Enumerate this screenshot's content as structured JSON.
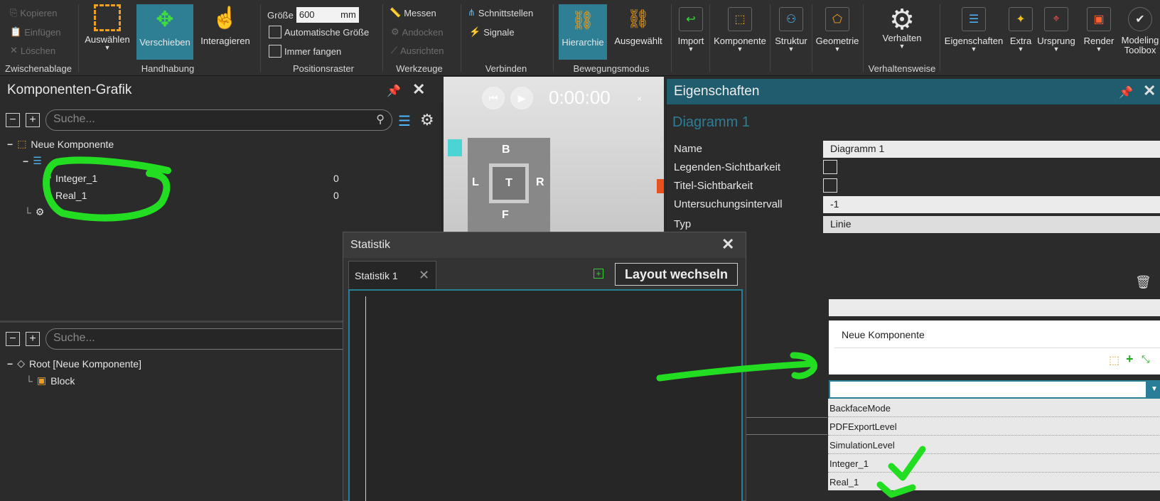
{
  "ribbon": {
    "clipboard": {
      "copy": "Kopieren",
      "paste": "Einfügen",
      "delete": "Löschen",
      "group": "Zwischenablage"
    },
    "handling": {
      "select": "Auswählen",
      "move": "Verschieben",
      "interact": "Interagieren",
      "group": "Handhabung"
    },
    "grid": {
      "size_label": "Größe",
      "size_value": "600",
      "size_unit": "mm",
      "auto_size": "Automatische Größe",
      "always_snap": "Immer fangen",
      "group": "Positionsraster"
    },
    "tools": {
      "measure": "Messen",
      "dock": "Andocken",
      "align": "Ausrichten",
      "group": "Werkzeuge"
    },
    "connect": {
      "interfaces": "Schnittstellen",
      "signals": "Signale",
      "group": "Verbinden"
    },
    "motion": {
      "hierarchy": "Hierarchie",
      "selected": "Ausgewählt",
      "group": "Bewegungsmodus"
    },
    "main": {
      "import": "Import",
      "component": "Komponente",
      "structure": "Struktur",
      "geometry": "Geometrie",
      "behaviors": "Verhalten",
      "behaviors_group": "Verhaltensweise",
      "properties": "Eigenschaften",
      "extra": "Extra",
      "origin": "Ursprung",
      "render": "Render",
      "modeling_toolbox_1": "Modeling",
      "modeling_toolbox_2": "Toolbox"
    }
  },
  "component_graph": {
    "title": "Komponenten-Grafik",
    "search_placeholder": "Suche...",
    "tree": {
      "root": "Neue Komponente",
      "items": [
        {
          "label": "Integer_1",
          "value": "0"
        },
        {
          "label": "Real_1",
          "value": "0"
        }
      ]
    }
  },
  "lower_tree": {
    "search_placeholder": "Suche...",
    "root": "Root [Neue Komponente]",
    "child": "Block"
  },
  "viewport": {
    "time": "0:00:00",
    "cube": {
      "top": "B",
      "center": "T",
      "left": "L",
      "right": "R",
      "bottom": "F"
    }
  },
  "statistics": {
    "title": "Statistik",
    "tab": "Statistik 1",
    "layout_button": "Layout wechseln"
  },
  "properties": {
    "title": "Eigenschaften",
    "object_name": "Diagramm 1",
    "rows": {
      "name_label": "Name",
      "name_value": "Diagramm 1",
      "legend_label": "Legenden-Sichtbarkeit",
      "title_label": "Titel-Sichtbarkeit",
      "interval_label": "Untersuchungsintervall",
      "interval_value": "-1",
      "type_label": "Typ",
      "type_value": "Linie"
    },
    "component_item": "Neue Komponente",
    "dropdown_options": [
      "BackfaceMode",
      "PDFExportLevel",
      "SimulationLevel",
      "Integer_1",
      "Real_1"
    ]
  },
  "colors": {
    "accent": "#2f7f94",
    "annotation": "#22dd22",
    "background": "#2b2b2b"
  }
}
